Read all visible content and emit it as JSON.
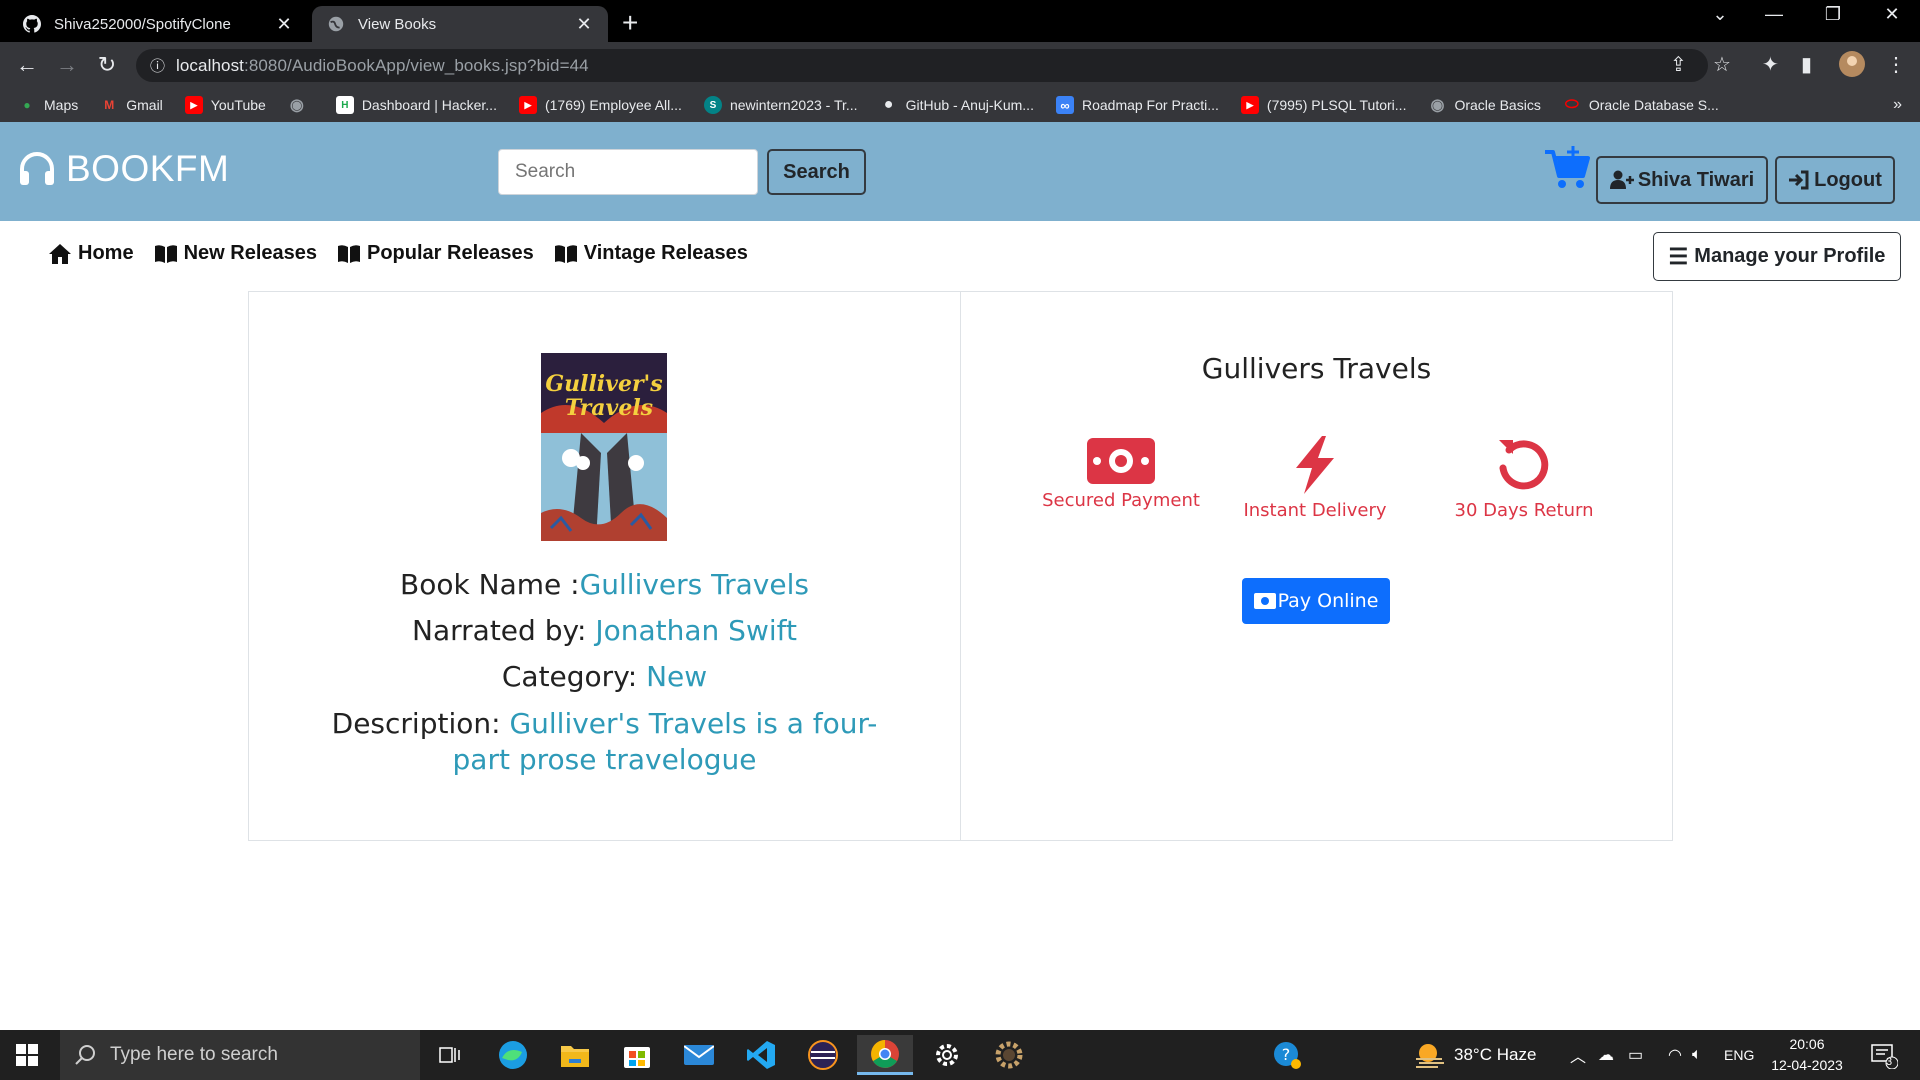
{
  "browser": {
    "tabs": [
      {
        "title": "Shiva252000/SpotifyClone",
        "icon": "github-icon"
      },
      {
        "title": "View Books",
        "icon": "globe-icon"
      }
    ],
    "new_tab": "+",
    "window_controls": {
      "minimize": "—",
      "restore": "❐",
      "close": "✕",
      "dropdown": "⌄"
    },
    "url_host": "localhost",
    "url_rest": ":8080/AudioBookApp/view_books.jsp?bid=44",
    "bookmarks": [
      {
        "label": "Maps",
        "icon": "maps-icon"
      },
      {
        "label": "Gmail",
        "icon": "gmail-icon"
      },
      {
        "label": "YouTube",
        "icon": "youtube-icon"
      },
      {
        "label": "",
        "icon": "globe-icon"
      },
      {
        "label": "Dashboard | Hacker...",
        "icon": "hackerrank-icon"
      },
      {
        "label": "(1769) Employee All...",
        "icon": "youtube-icon"
      },
      {
        "label": "newintern2023 - Tr...",
        "icon": "sharepoint-icon"
      },
      {
        "label": "GitHub - Anuj-Kum...",
        "icon": "github-icon"
      },
      {
        "label": "Roadmap For Practi...",
        "icon": "infinity-icon"
      },
      {
        "label": "(7995) PLSQL Tutori...",
        "icon": "youtube-icon"
      },
      {
        "label": "Oracle Basics",
        "icon": "globe-icon"
      },
      {
        "label": "Oracle Database S...",
        "icon": "oracle-icon"
      }
    ],
    "bookmarks_more": "»"
  },
  "site": {
    "brand": "BOOKFM",
    "search_placeholder": "Search",
    "search_button": "Search",
    "user_button": "Shiva Tiwari",
    "logout_button": "Logout",
    "nav": [
      "Home",
      "New Releases",
      "Popular Releases",
      "Vintage Releases"
    ],
    "profile_button": "Manage your Profile"
  },
  "book": {
    "name_label": "Book Name :",
    "name": "Gullivers Travels",
    "narrator_label": "Narrated by: ",
    "narrator": "Jonathan Swift",
    "category_label": "Category: ",
    "category": "New",
    "description_label": "Description: ",
    "description": "Gulliver's Travels is a four-part prose travelogue",
    "cover_title_line1": "Gulliver's",
    "cover_title_line2": "Travels"
  },
  "purchase": {
    "title": "Gullivers Travels",
    "features": [
      "Secured Payment",
      "Instant Delivery",
      "30 Days Return"
    ],
    "pay_button": "Pay Online",
    "accent_color": "#dc3545",
    "button_color": "#0d6efd"
  },
  "taskbar": {
    "search_placeholder": "Type here to search",
    "weather": "38°C  Haze",
    "language": "ENG",
    "time": "20:06",
    "date": "12-04-2023",
    "notifications": "3"
  }
}
